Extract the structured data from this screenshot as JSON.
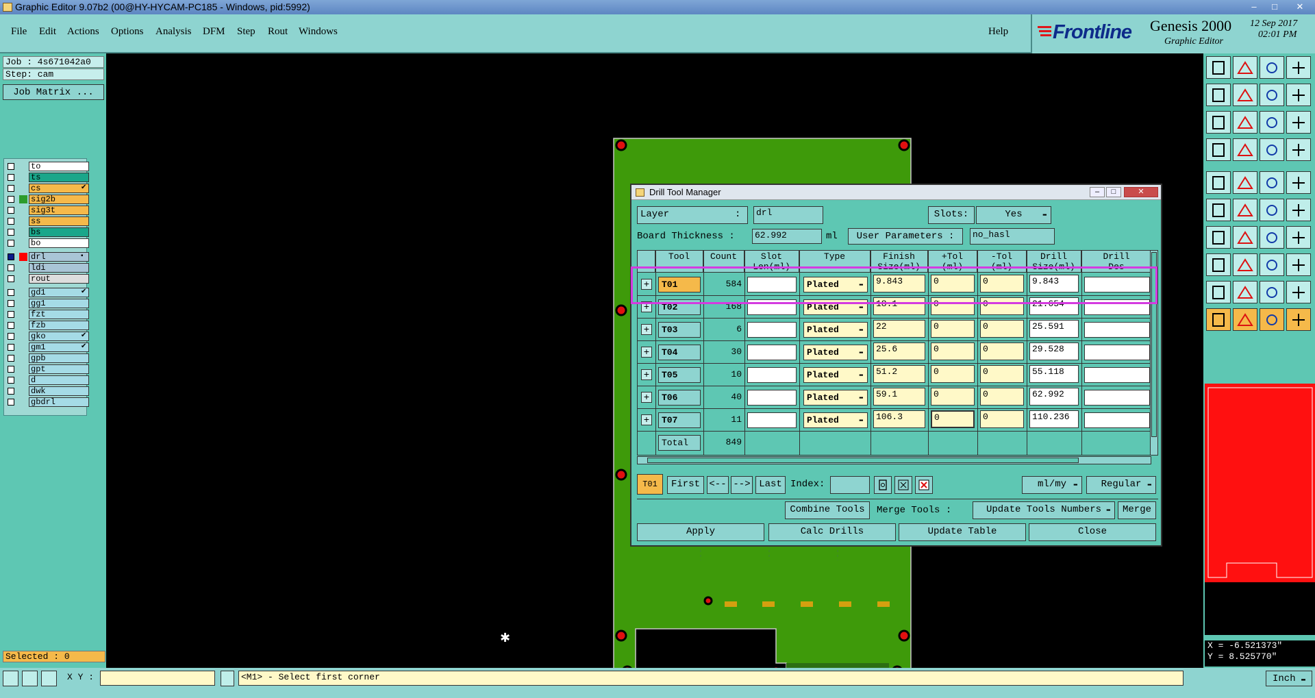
{
  "window": {
    "title": "Graphic Editor 9.07b2 (00@HY-HYCAM-PC185 - Windows, pid:5992)",
    "min_glyph": "–",
    "max_glyph": "□",
    "close_glyph": "✕"
  },
  "menu": {
    "file": "File",
    "edit": "Edit",
    "actions": "Actions",
    "options": "Options",
    "analysis": "Analysis",
    "dfm": "DFM",
    "step": "Step",
    "rout": "Rout",
    "windows": "Windows",
    "help": "Help"
  },
  "brand": {
    "logo": "Frontline",
    "product": "Genesis 2000",
    "subtitle": "Graphic Editor",
    "date": "12 Sep 2017",
    "time": "02:01 PM"
  },
  "left": {
    "job": "Job : 4s671042a0",
    "step": "Step: cam",
    "job_matrix": "Job Matrix ...",
    "selected": "Selected : 0",
    "layers": [
      {
        "name": "to",
        "color": "#ffffff"
      },
      {
        "name": "ts",
        "color": "#1aa68a"
      },
      {
        "name": "cs",
        "color": "#f5b94a",
        "mark": "✔"
      },
      {
        "name": "sig2b",
        "color": "#f5b94a",
        "sw": "#2c9c2c"
      },
      {
        "name": "sig3t",
        "color": "#f5b94a"
      },
      {
        "name": "ss",
        "color": "#f5b94a"
      },
      {
        "name": "bs",
        "color": "#1aa68a"
      },
      {
        "name": "bo",
        "color": "#ffffff"
      },
      {
        "name": "drl",
        "color": "#a9c5d6",
        "sw": "#ff0000",
        "mark": "▪",
        "sel": true
      },
      {
        "name": "ldi",
        "color": "#a9c5d6"
      },
      {
        "name": "rout",
        "color": "#dddddd"
      },
      {
        "name": "gd1",
        "color": "#a5dbe6",
        "mark": "✔"
      },
      {
        "name": "gg1",
        "color": "#a5dbe6"
      },
      {
        "name": "fzt",
        "color": "#a5dbe6"
      },
      {
        "name": "fzb",
        "color": "#a5dbe6"
      },
      {
        "name": "gko",
        "color": "#a5dbe6",
        "mark": "✔"
      },
      {
        "name": "gm1",
        "color": "#a5dbe6",
        "mark": "✔"
      },
      {
        "name": "gpb",
        "color": "#a5dbe6"
      },
      {
        "name": "gpt",
        "color": "#a5dbe6"
      },
      {
        "name": "d",
        "color": "#a5dbe6"
      },
      {
        "name": "dwk",
        "color": "#a5dbe6"
      },
      {
        "name": "gbdrl",
        "color": "#a5dbe6"
      }
    ]
  },
  "status": {
    "xy_label": "X Y :",
    "xy_value": "",
    "message": "<M1> - Select first corner",
    "units": "Inch"
  },
  "coords": {
    "x": "X = -6.521373\"",
    "y": "Y = 8.525770\""
  },
  "dialog": {
    "title": "Drill Tool Manager",
    "layer_label": "Layer",
    "layer_colon": ":",
    "layer_value": "drl",
    "slots_label": "Slots:",
    "slots_value": "Yes",
    "thickness_label": "Board Thickness :",
    "thickness_value": "62.992",
    "thickness_unit": "ml",
    "user_params_label": "User Parameters :",
    "user_params_value": "no_hasl",
    "columns": [
      {
        "l1": "",
        "l2": ""
      },
      {
        "l1": "Tool",
        "l2": ""
      },
      {
        "l1": "Count",
        "l2": ""
      },
      {
        "l1": "Slot",
        "l2": "Len(ml)"
      },
      {
        "l1": "Type",
        "l2": ""
      },
      {
        "l1": "Finish",
        "l2": "Size(ml)"
      },
      {
        "l1": "+Tol",
        "l2": "(ml)"
      },
      {
        "l1": "-Tol",
        "l2": "(ml)"
      },
      {
        "l1": "Drill",
        "l2": "Size(ml)"
      },
      {
        "l1": "Drill",
        "l2": "Des"
      }
    ],
    "rows": [
      {
        "tool": "T01",
        "count": "584",
        "slot": "",
        "type": "Plated",
        "finish": "9.843",
        "ptol": "0",
        "mtol": "0",
        "drill": "9.843",
        "des": ""
      },
      {
        "tool": "T02",
        "count": "168",
        "slot": "",
        "type": "Plated",
        "finish": "18.1",
        "ptol": "0",
        "mtol": "0",
        "drill": "21.654",
        "des": ""
      },
      {
        "tool": "T03",
        "count": "6",
        "slot": "",
        "type": "Plated",
        "finish": "22",
        "ptol": "0",
        "mtol": "0",
        "drill": "25.591",
        "des": ""
      },
      {
        "tool": "T04",
        "count": "30",
        "slot": "",
        "type": "Plated",
        "finish": "25.6",
        "ptol": "0",
        "mtol": "0",
        "drill": "29.528",
        "des": ""
      },
      {
        "tool": "T05",
        "count": "10",
        "slot": "",
        "type": "Plated",
        "finish": "51.2",
        "ptol": "0",
        "mtol": "0",
        "drill": "55.118",
        "des": ""
      },
      {
        "tool": "T06",
        "count": "40",
        "slot": "",
        "type": "Plated",
        "finish": "59.1",
        "ptol": "0",
        "mtol": "0",
        "drill": "62.992",
        "des": ""
      },
      {
        "tool": "T07",
        "count": "11",
        "slot": "",
        "type": "Plated",
        "finish": "106.3",
        "ptol": "0",
        "mtol": "0",
        "drill": "110.236",
        "des": ""
      }
    ],
    "total_label": "Total",
    "total_count": "849",
    "nav": {
      "current": "T01",
      "first": "First",
      "prev": "<--",
      "next": "-->",
      "last": "Last",
      "index_label": "Index:",
      "index_value": "",
      "units": "ml/my",
      "mode": "Regular"
    },
    "combine_tools": "Combine Tools",
    "merge_tools_label": "Merge Tools :",
    "merge_option": "Update Tools Numbers",
    "merge_button": "Merge",
    "apply": "Apply",
    "calc_drills": "Calc Drills",
    "update_table": "Update Table",
    "close": "Close"
  },
  "colors": {
    "panel": "#5ec7b3",
    "menu": "#8ed4d0",
    "board": "#3e9a0a",
    "highlight": "#d43ae0",
    "pad": "#e01010",
    "selected_tool": "#f5b94a"
  }
}
